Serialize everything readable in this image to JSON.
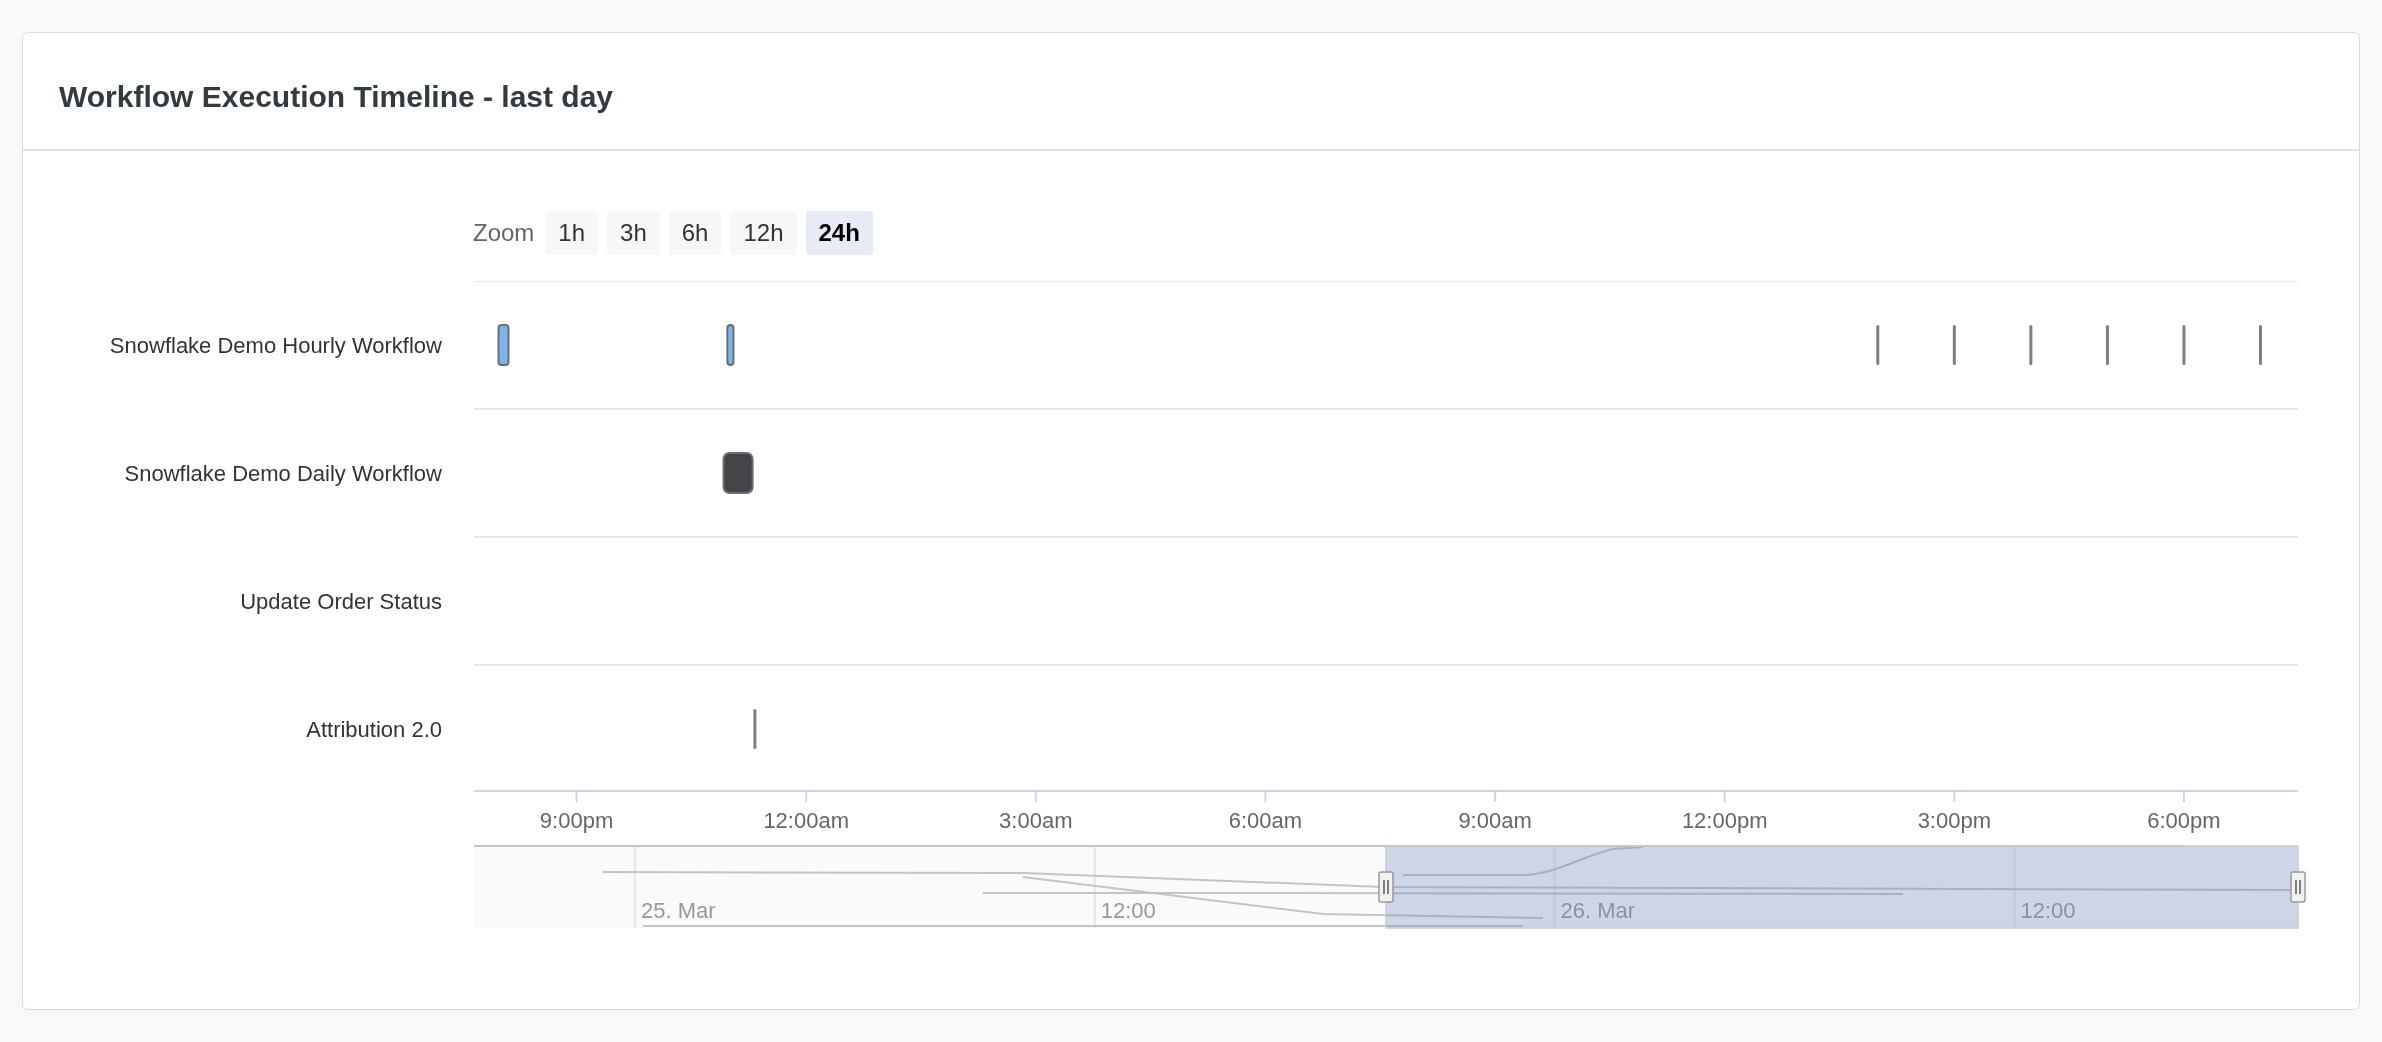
{
  "card": {
    "title": "Workflow Execution Timeline - last day"
  },
  "zoom": {
    "label": "Zoom",
    "buttons": [
      {
        "label": "1h",
        "selected": false
      },
      {
        "label": "3h",
        "selected": false
      },
      {
        "label": "6h",
        "selected": false
      },
      {
        "label": "12h",
        "selected": false
      },
      {
        "label": "24h",
        "selected": true
      }
    ]
  },
  "timeline": {
    "rows": [
      "Snowflake Demo Hourly Workflow",
      "Snowflake Demo Daily Workflow",
      "Update Order Status",
      "Attribution 2.0"
    ],
    "axis_labels": [
      "9:00pm",
      "12:00am",
      "3:00am",
      "6:00am",
      "9:00am",
      "12:00pm",
      "3:00pm",
      "6:00pm"
    ]
  },
  "navigator": {
    "labels": [
      "25. Mar",
      "12:00",
      "26. Mar",
      "12:00"
    ],
    "level": 0.5
  }
}
